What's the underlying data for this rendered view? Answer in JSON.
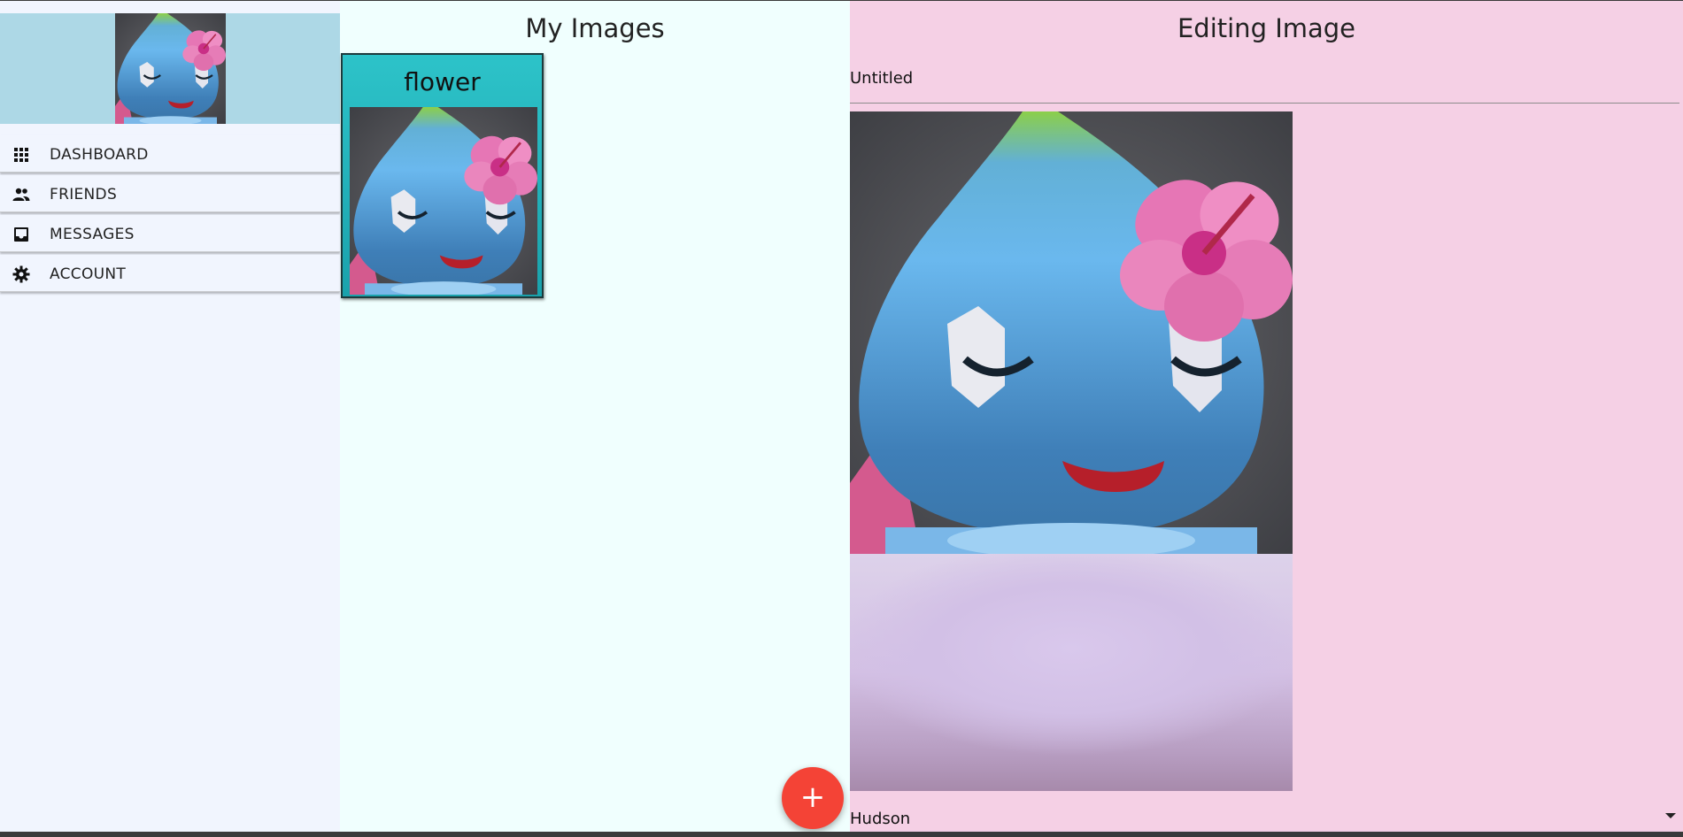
{
  "sidebar": {
    "avatar_alt": "Profile picture",
    "items": [
      {
        "label": "DASHBOARD",
        "icon": "apps-grid-icon"
      },
      {
        "label": "FRIENDS",
        "icon": "people-icon"
      },
      {
        "label": "MESSAGES",
        "icon": "inbox-icon"
      },
      {
        "label": "ACCOUNT",
        "icon": "gear-icon"
      }
    ]
  },
  "images": {
    "title": "My Images",
    "cards": [
      {
        "title": "flower"
      }
    ],
    "add_button_label": "+"
  },
  "editor": {
    "title": "Editing Image",
    "title_field_value": "Untitled",
    "font_select_value": "Hudson"
  },
  "colors": {
    "sidebar_bg": "#f1f5fe",
    "avatar_bar_bg": "#add8e6",
    "images_bg": "#f0fffe",
    "editor_bg": "#f5d0e5",
    "card_bg": "#2dc3c9",
    "fab_bg": "#f44336"
  }
}
